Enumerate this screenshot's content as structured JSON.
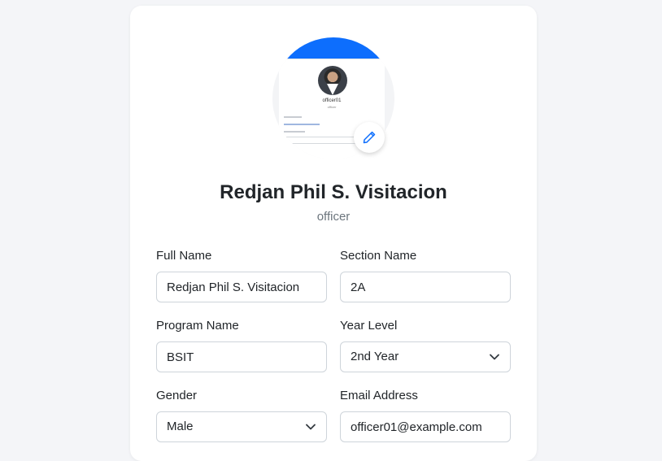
{
  "profile": {
    "name": "Redjan Phil S. Visitacion",
    "role": "officer",
    "avatar_preview": {
      "username": "officer01",
      "role": "officer"
    }
  },
  "form": {
    "full_name": {
      "label": "Full Name",
      "value": "Redjan Phil S. Visitacion"
    },
    "section_name": {
      "label": "Section Name",
      "value": "2A"
    },
    "program_name": {
      "label": "Program Name",
      "value": "BSIT"
    },
    "year_level": {
      "label": "Year Level",
      "value": "2nd Year"
    },
    "gender": {
      "label": "Gender",
      "value": "Male"
    },
    "email": {
      "label": "Email Address",
      "value": "officer01@example.com"
    }
  },
  "icons": {
    "edit": "pencil-icon",
    "select": "chevron-down-icon"
  },
  "colors": {
    "accent": "#0d6efd",
    "page_bg": "#f4f5f8",
    "card_bg": "#ffffff",
    "muted_text": "#6c757d",
    "border": "#ced4da"
  }
}
